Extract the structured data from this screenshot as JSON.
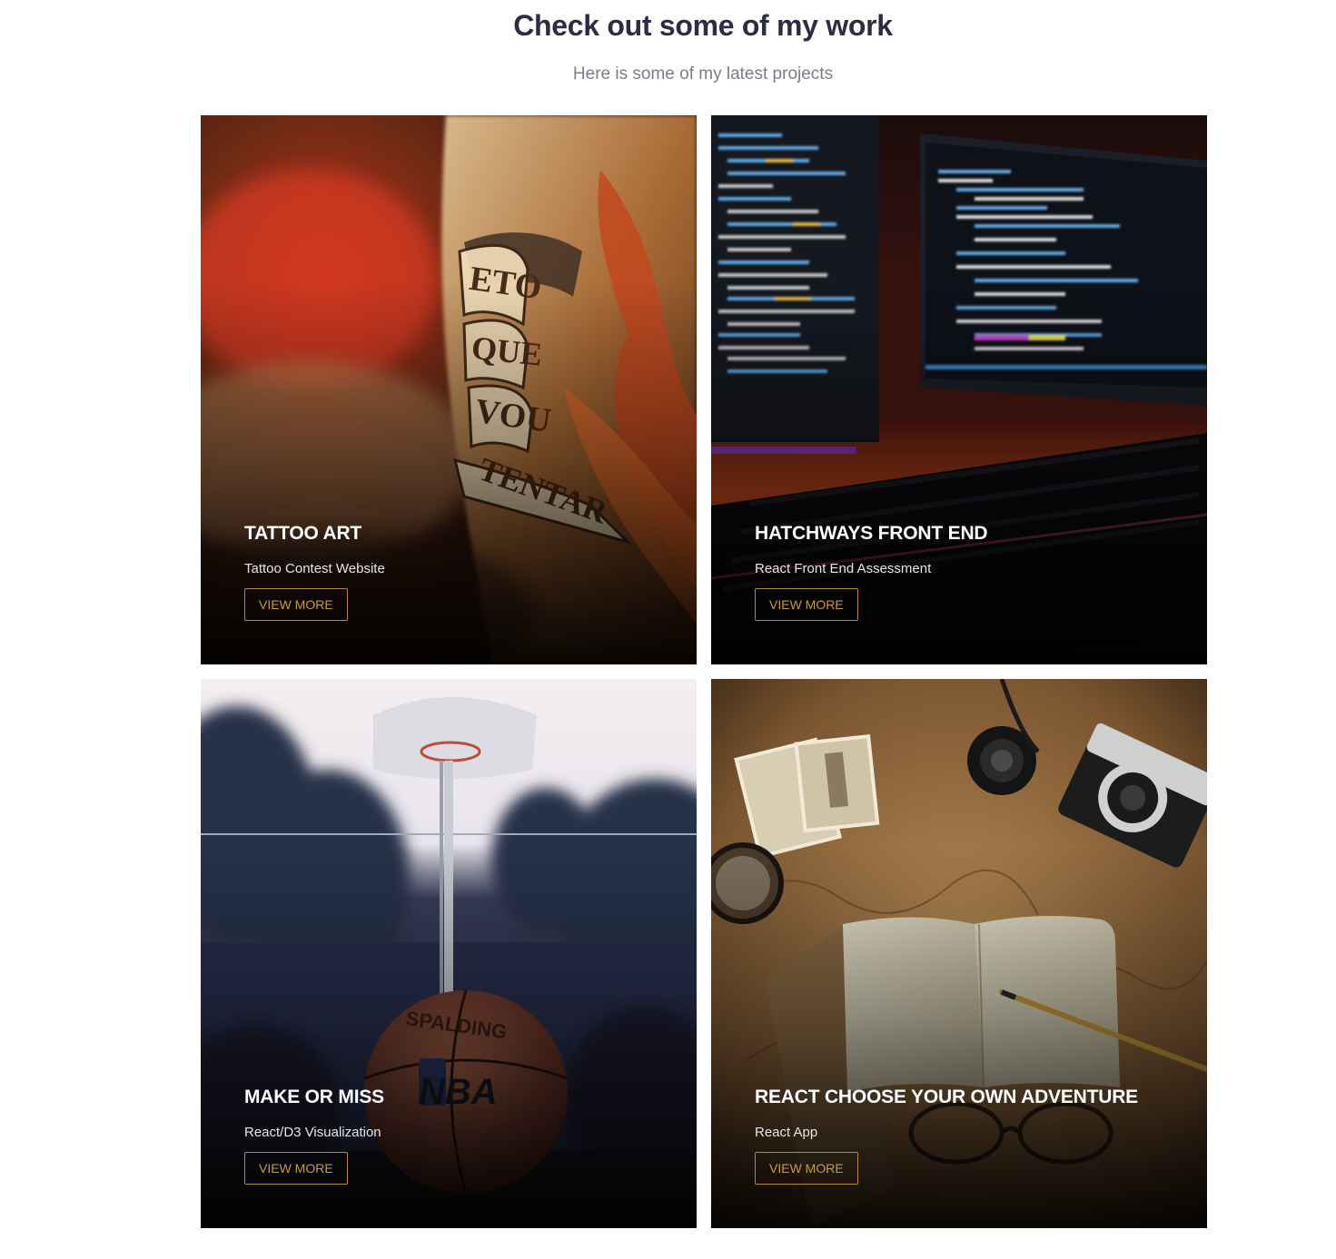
{
  "header": {
    "title": "Check out some of my work",
    "subtitle": "Here is some of my latest projects"
  },
  "projects": [
    {
      "title": "TATTOO ART",
      "description": "Tattoo Contest Website",
      "button_label": "VIEW MORE",
      "image_subject": "tattooed-arm-photo",
      "image_text": [
        "ETO",
        "QUE",
        "VOU",
        "TENTAR"
      ]
    },
    {
      "title": "HATCHWAYS FRONT END",
      "description": "React Front End Assessment",
      "button_label": "VIEW MORE",
      "image_subject": "code-monitor-keyboard-photo"
    },
    {
      "title": "MAKE OR MISS",
      "description": "React/D3 Visualization",
      "button_label": "VIEW MORE",
      "image_subject": "basketball-court-photo",
      "image_text": [
        "SPALDING",
        "NBA"
      ]
    },
    {
      "title": "REACT CHOOSE YOUR OWN ADVENTURE",
      "description": "React App",
      "button_label": "VIEW MORE",
      "image_subject": "map-camera-notebook-photo"
    }
  ],
  "colors": {
    "heading": "#2b2d42",
    "subheading": "#7a7d8c",
    "button_accent": "#c89a3c",
    "card_title": "#ffffff"
  }
}
